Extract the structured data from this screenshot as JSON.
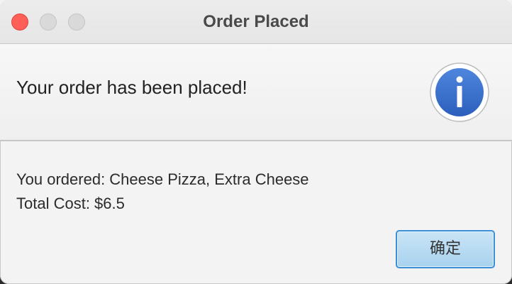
{
  "window": {
    "title": "Order Placed"
  },
  "header": {
    "message": "Your order has been placed!",
    "icon": "info-icon",
    "icon_color": "#3a6cc8"
  },
  "content": {
    "lines": [
      "You ordered: Cheese Pizza, Extra Cheese",
      "Total Cost: $6.5"
    ]
  },
  "buttons": {
    "ok_label": "确定"
  },
  "colors": {
    "close_button": "#fe5f57",
    "inactive_button": "#d9d9d9",
    "default_button_border": "#3d8fd6"
  }
}
